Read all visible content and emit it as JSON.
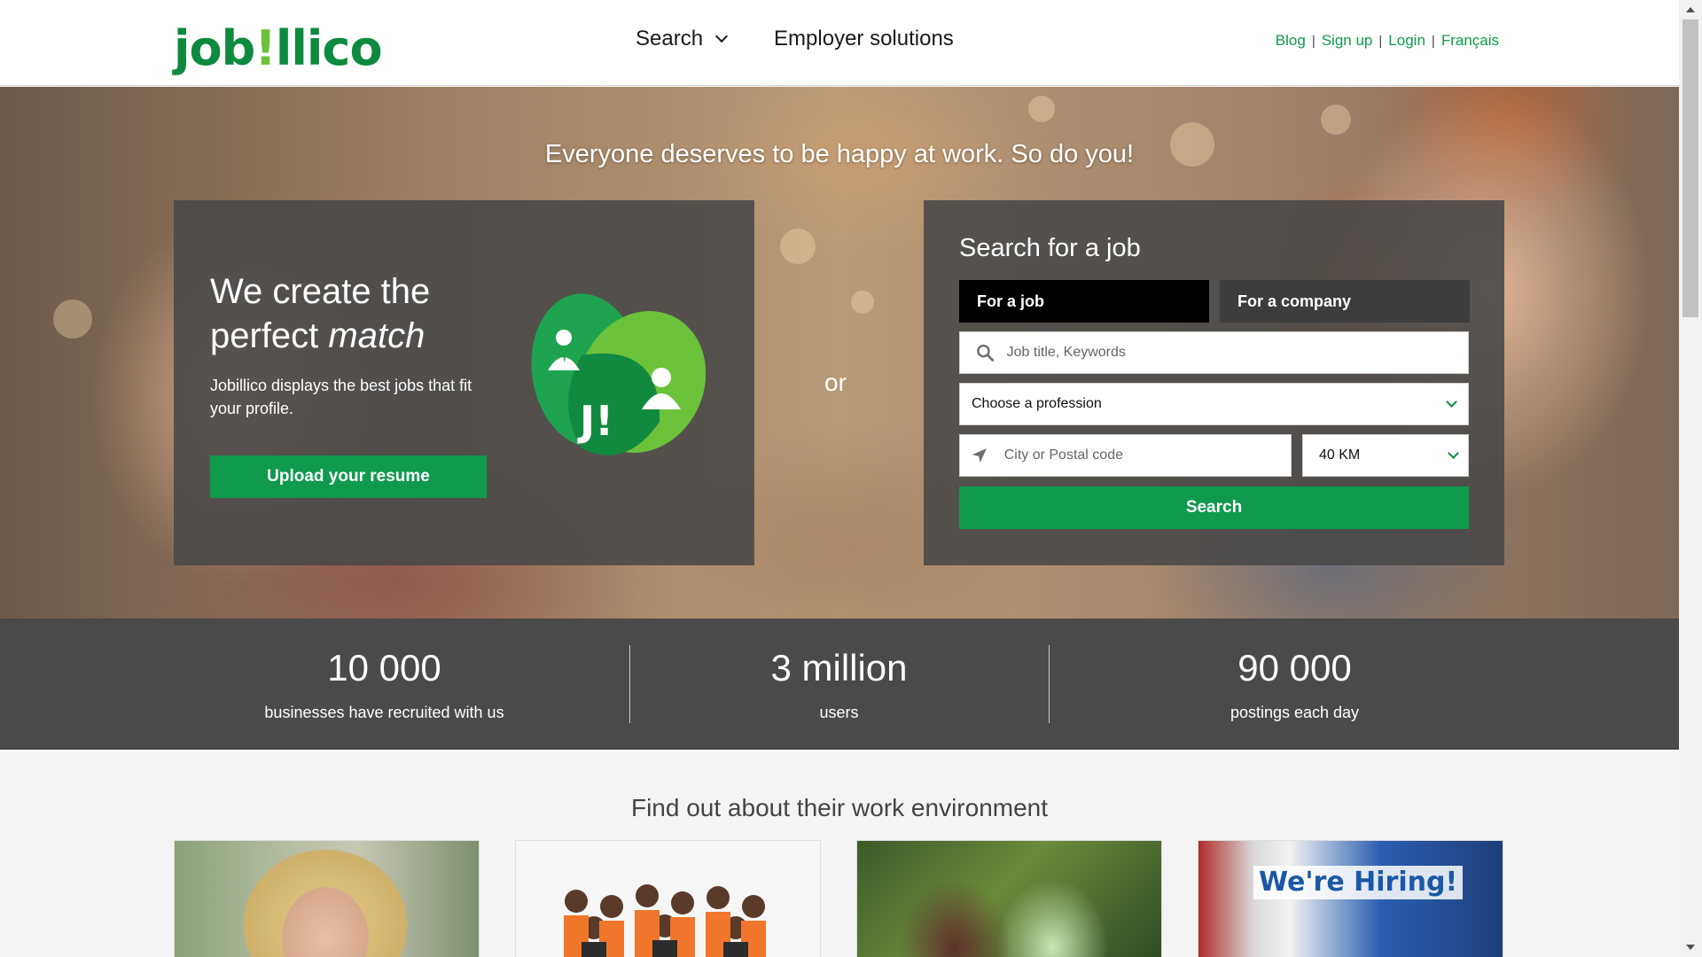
{
  "header": {
    "logo_prefix": "job",
    "logo_accent": "!",
    "logo_suffix": "llico",
    "nav": {
      "search_label": "Search",
      "employer_label": "Employer solutions"
    },
    "links": {
      "blog": "Blog",
      "signup": "Sign up",
      "login": "Login",
      "language": "Français",
      "separator": "|"
    }
  },
  "hero": {
    "tagline": "Everyone deserves to be happy at work. So do you!",
    "match": {
      "title_line1": "We create the",
      "title_line2": "perfect",
      "title_emphasis": "match",
      "description": "Jobillico displays the best jobs that fit your profile.",
      "upload_button": "Upload your resume",
      "badge_text": "J!"
    },
    "or_label": "or",
    "search": {
      "title": "Search for a job",
      "tabs": [
        "For a job",
        "For a company"
      ],
      "active_tab": "For a job",
      "keywords_placeholder": "Job title, Keywords",
      "profession_select": "Choose a profession",
      "city_placeholder": "City or Postal code",
      "radius_select": "40 KM",
      "submit_button": "Search"
    }
  },
  "stats": [
    {
      "value": "10 000",
      "label": "businesses have recruited with us"
    },
    {
      "value": "3 million",
      "label": "users"
    },
    {
      "value": "90 000",
      "label": "postings each day"
    }
  ],
  "work_environment": {
    "title": "Find out about their work environment",
    "hiring_sign": "We're Hiring!"
  },
  "icons": {
    "search": "search-icon",
    "location": "location-arrow-icon",
    "dropdown": "chevron-down-icon"
  },
  "colors": {
    "brand_green": "#0f9a4e",
    "brand_light_green": "#6cc23a",
    "link_green": "#0e9a4c",
    "panel_dark": "#484848",
    "stats_bg": "#4a4a4a"
  }
}
